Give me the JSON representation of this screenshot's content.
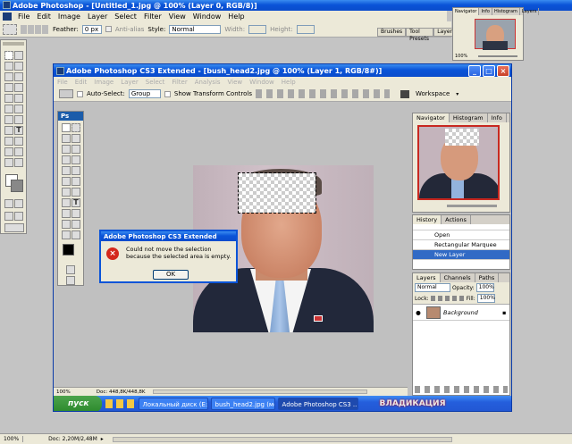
{
  "app": {
    "title": "Adobe Photoshop - [Untitled_1.jpg @ 100% (Layer 0, RGB/8)]"
  },
  "menu": [
    "File",
    "Edit",
    "Image",
    "Layer",
    "Select",
    "Filter",
    "View",
    "Window",
    "Help"
  ],
  "options": {
    "feather_label": "Feather:",
    "feather_value": "0 px",
    "antialias": "Anti-alias",
    "style_label": "Style:",
    "style_value": "Normal",
    "width_label": "Width:",
    "height_label": "Height:"
  },
  "top_tabs": [
    "Brushes",
    "Tool Presets",
    "Layer"
  ],
  "mini_nav": {
    "tabs": [
      "Navigator",
      "Info",
      "Histogram",
      "Layers"
    ],
    "zoom": "100%"
  },
  "status": {
    "zoom": "100%",
    "doc": "Doc: 2,20M/2,48M"
  },
  "cs3": {
    "title": "Adobe Photoshop CS3 Extended - [bush_head2.jpg @ 100% (Layer 1, RGB/8#)]",
    "menu": [
      "File",
      "Edit",
      "Image",
      "Layer",
      "Select",
      "Filter",
      "Analysis",
      "View",
      "Window",
      "Help"
    ],
    "auto_select": "Auto-Select:",
    "auto_select_value": "Group",
    "transform": "Show Transform Controls",
    "workspace": "Workspace",
    "ps_badge": "Ps",
    "navigator": {
      "tabs": [
        "Navigator",
        "Histogram",
        "Info"
      ]
    },
    "history": {
      "tabs": [
        "History",
        "Actions"
      ],
      "items": [
        "Open",
        "Rectangular Marquee",
        "New Layer"
      ]
    },
    "layers": {
      "tabs": [
        "Layers",
        "Channels",
        "Paths"
      ],
      "blend": "Normal",
      "opacity_label": "Opacity:",
      "opacity": "100%",
      "lock": "Lock:",
      "fill_label": "Fill:",
      "fill": "100%",
      "layer_name": "Background"
    },
    "status": {
      "zoom": "100%",
      "doc": "Doc: 448,8K/448,8K"
    }
  },
  "dialog": {
    "title": "Adobe Photoshop CS3 Extended",
    "message": "Could not move the selection because the selected area is empty.",
    "ok": "OK"
  },
  "taskbar": {
    "start": "пуск",
    "items": [
      "Локальный диск (E:)",
      "bush_head2.jpg (моо...",
      "Adobe Photoshop CS3 ..."
    ],
    "watermark": "ВЛАДИКАЦИЯ"
  },
  "colors": {
    "xp_blue": "#0a54d8",
    "selection": "#316ac5",
    "panel": "#ece9d8"
  }
}
